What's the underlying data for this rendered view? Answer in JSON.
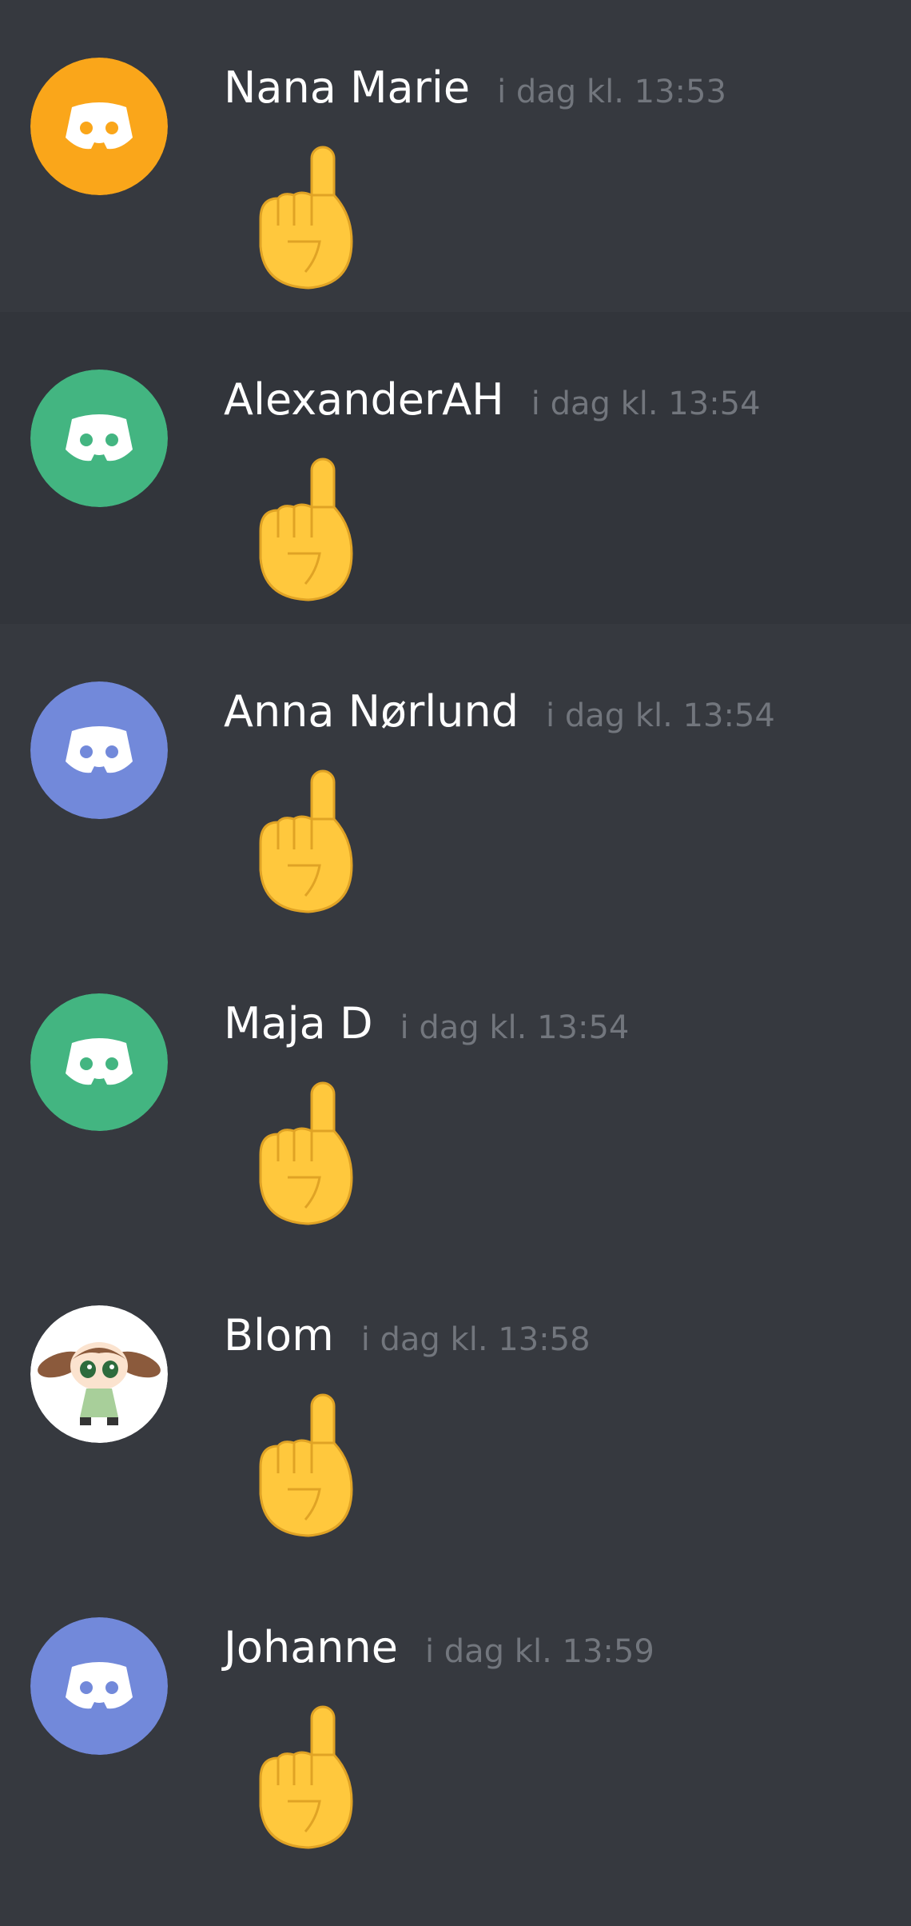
{
  "messages": [
    {
      "username": "Nana Marie",
      "timestamp": "i dag kl. 13:53",
      "avatar_color": "#faa61a",
      "avatar_icon": "discord-logo-icon",
      "content": "pointing-up-emoji"
    },
    {
      "username": "AlexanderAH",
      "timestamp": "i dag kl. 13:54",
      "avatar_color": "#43b581",
      "avatar_icon": "discord-logo-icon",
      "content": "pointing-up-emoji"
    },
    {
      "username": "Anna Nørlund",
      "timestamp": "i dag kl. 13:54",
      "avatar_color": "#7289da",
      "avatar_icon": "discord-logo-icon",
      "content": "pointing-up-emoji"
    },
    {
      "username": "Maja D",
      "timestamp": "i dag kl. 13:54",
      "avatar_color": "#43b581",
      "avatar_icon": "discord-logo-icon",
      "content": "pointing-up-emoji"
    },
    {
      "username": "Blom",
      "timestamp": "i dag kl. 13:58",
      "avatar_color": "#ffffff",
      "avatar_icon": "cartoon-girl-avatar-icon",
      "content": "pointing-up-emoji"
    },
    {
      "username": "Johanne",
      "timestamp": "i dag kl. 13:59",
      "avatar_color": "#7289da",
      "avatar_icon": "discord-logo-icon",
      "content": "pointing-up-emoji"
    }
  ],
  "colors": {
    "background": "#36393f",
    "hover_background": "#32353b",
    "username": "#ffffff",
    "timestamp": "#72767d",
    "emoji_skin": "#ffc83d",
    "emoji_outline": "#e0a325"
  }
}
